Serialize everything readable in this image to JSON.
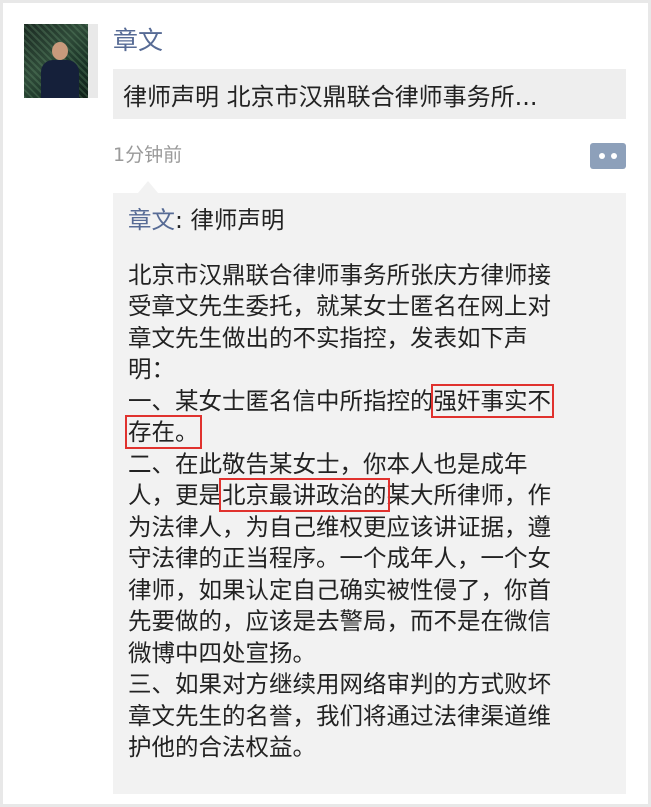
{
  "post": {
    "author": "章文",
    "link_title": "律师声明  北京市汉鼎联合律师事务所...",
    "time": "1分钟前"
  },
  "comment": {
    "author": "章文",
    "sep": ": ",
    "heading": "律师声明",
    "lines": [
      "北京市汉鼎联合律师事务所张庆方律师接",
      "受章文先生委托，就某女士匿名在网上对",
      "章文先生做出的不实指控，发表如下声",
      "明："
    ],
    "p1_a": "一、某女士匿名信中所指控的",
    "p1_hl1": "强奸事实不",
    "p1_hl2": "存在。",
    "p2_l1": "二、在此敬告某女士，你本人也是成年",
    "p2_l2_a": "人，更是",
    "p2_l2_hl": "北京最讲政治的",
    "p2_l2_b": "某大所律师，作",
    "p2_rest": [
      "为法律人，为自己维权更应该讲证据，遵",
      "守法律的正当程序。一个成年人，一个女",
      "律师，如果认定自己确实被性侵了，你首",
      "先要做的，应该是去警局，而不是在微信",
      "微博中四处宣扬。"
    ],
    "p3": [
      "三、如果对方继续用网络审判的方式败坏",
      "章文先生的名誉，我们将通过法律渠道维",
      "护他的合法权益。"
    ]
  },
  "icons": {
    "avatar": "user-avatar-photo",
    "more": "more-dots-icon"
  },
  "colors": {
    "name_blue": "#576b95",
    "highlight_red": "#e0322e",
    "button_bg": "#8da0ba"
  }
}
